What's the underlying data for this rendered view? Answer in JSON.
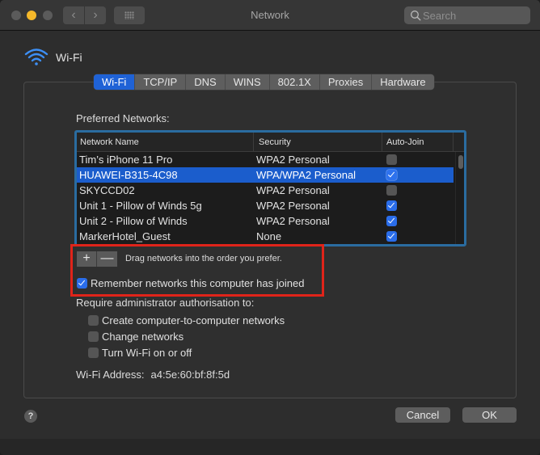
{
  "window": {
    "title": "Network",
    "search_placeholder": "Search",
    "nav_back": "‹",
    "nav_forward": "›"
  },
  "service": {
    "icon": "wifi-icon",
    "name": "Wi-Fi"
  },
  "tabs": [
    {
      "label": "Wi-Fi",
      "active": true
    },
    {
      "label": "TCP/IP",
      "active": false
    },
    {
      "label": "DNS",
      "active": false
    },
    {
      "label": "WINS",
      "active": false
    },
    {
      "label": "802.1X",
      "active": false
    },
    {
      "label": "Proxies",
      "active": false
    },
    {
      "label": "Hardware",
      "active": false
    }
  ],
  "preferred_networks": {
    "label": "Preferred Networks:",
    "columns": [
      "Network Name",
      "Security",
      "Auto-Join"
    ],
    "rows": [
      {
        "name": "Tim’s iPhone 11 Pro",
        "security": "WPA2 Personal",
        "auto_join": false,
        "selected": false
      },
      {
        "name": "HUAWEI-B315-4C98",
        "security": "WPA/WPA2 Personal",
        "auto_join": true,
        "selected": true
      },
      {
        "name": "SKYCCD02",
        "security": "WPA2 Personal",
        "auto_join": false,
        "selected": false
      },
      {
        "name": "Unit 1 - Pillow of Winds 5g",
        "security": "WPA2 Personal",
        "auto_join": true,
        "selected": false
      },
      {
        "name": "Unit 2 - Pillow of Winds",
        "security": "WPA2 Personal",
        "auto_join": true,
        "selected": false
      },
      {
        "name": "MarkerHotel_Guest",
        "security": "None",
        "auto_join": true,
        "selected": false
      }
    ],
    "add_label": "+",
    "remove_label": "—",
    "drag_hint": "Drag networks into the order you prefer."
  },
  "remember": {
    "label": "Remember networks this computer has joined",
    "checked": true
  },
  "admin": {
    "label": "Require administrator authorisation to:",
    "options": [
      {
        "label": "Create computer-to-computer networks",
        "checked": false
      },
      {
        "label": "Change networks",
        "checked": false
      },
      {
        "label": "Turn Wi-Fi on or off",
        "checked": false
      }
    ]
  },
  "address": {
    "label": "Wi-Fi Address:",
    "value": "a4:5e:60:bf:8f:5d"
  },
  "footer": {
    "help_label": "?",
    "cancel_label": "Cancel",
    "ok_label": "OK"
  },
  "colors": {
    "accent": "#1f62d6",
    "highlight_box": "#e0241a",
    "traffic_minimize": "#f5b82a"
  }
}
